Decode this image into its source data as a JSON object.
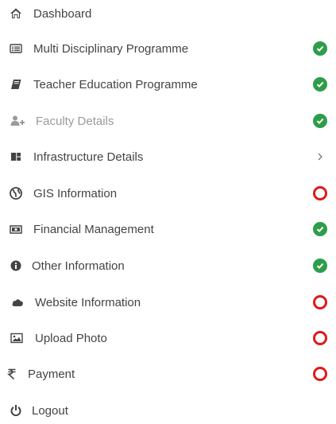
{
  "menu": {
    "items": [
      {
        "label": "Dashboard",
        "icon": "home-icon",
        "status": "none"
      },
      {
        "label": "Multi Disciplinary Programme",
        "icon": "list-icon",
        "status": "complete"
      },
      {
        "label": "Teacher Education Programme",
        "icon": "book-icon",
        "status": "complete"
      },
      {
        "label": "Faculty Details",
        "icon": "add-user-icon",
        "status": "complete"
      },
      {
        "label": "Infrastructure Details",
        "icon": "building-icon",
        "status": "expand"
      },
      {
        "label": "GIS Information",
        "icon": "globe-icon",
        "status": "pending"
      },
      {
        "label": "Financial Management",
        "icon": "money-icon",
        "status": "complete"
      },
      {
        "label": "Other Information",
        "icon": "info-icon",
        "status": "complete"
      },
      {
        "label": "Website Information",
        "icon": "cloud-icon",
        "status": "pending"
      },
      {
        "label": "Upload Photo",
        "icon": "image-icon",
        "status": "pending"
      },
      {
        "label": "Payment",
        "icon": "rupee-icon",
        "status": "pending"
      },
      {
        "label": "Logout",
        "icon": "power-icon",
        "status": "none"
      }
    ]
  },
  "colors": {
    "text": "#444444",
    "disabled_text": "#9a9a9a",
    "complete": "#2e9d4a",
    "pending": "#e0191a"
  }
}
